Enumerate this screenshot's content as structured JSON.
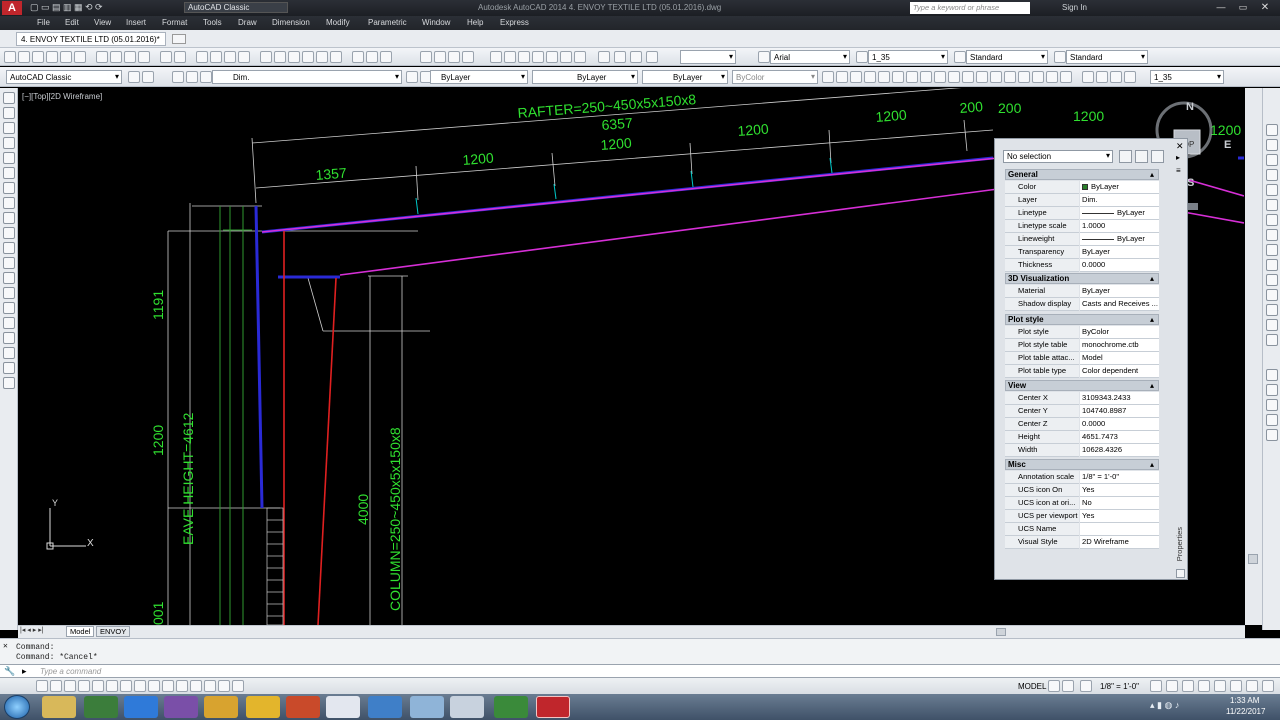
{
  "app": {
    "title": "Autodesk AutoCAD 2014    4. ENVOY TEXTILE LTD (05.01.2016).dwg",
    "workspace_quick": "AutoCAD Classic",
    "search_placeholder": "Type a keyword or phrase",
    "signin": "Sign In"
  },
  "menu": [
    "File",
    "Edit",
    "View",
    "Insert",
    "Format",
    "Tools",
    "Draw",
    "Dimension",
    "Modify",
    "Parametric",
    "Window",
    "Help",
    "Express"
  ],
  "doctab": "4. ENVOY TEXTILE LTD (05.01.2016)*",
  "toolbar": {
    "workspace": "AutoCAD Classic",
    "layer": "Dim.",
    "color": "ByLayer",
    "linetype": "ByLayer",
    "lineweight": "ByLayer",
    "plotstyle": "ByColor",
    "font": "Arial",
    "dimstyle": "1_35",
    "textstyle": "Standard",
    "tablestyle": "Standard",
    "scale": "1_35"
  },
  "viewport": {
    "label": "[−][Top][2D Wireframe]"
  },
  "drawing": {
    "rafter": "RAFTER=250~450x5x150x8",
    "total": "6357",
    "seg1": "1357",
    "seg2": "1200",
    "seg3": "1200",
    "seg4": "1200",
    "seg5": "1200",
    "seg6": "200",
    "seg7": "200",
    "seg8": "1200",
    "seg9": "1200",
    "column": "COLUMN=250~450x5x150x8",
    "eave": "EAVE HEIGHT=4612",
    "v1": "1191",
    "v2": "1200",
    "v3": "4000",
    "v4": "001"
  },
  "viewcube": {
    "n": "N",
    "e": "E",
    "s": "S",
    "top": "TOP"
  },
  "ucs": {
    "x": "X",
    "y": "Y"
  },
  "properties": {
    "selection": "No selection",
    "side_title": "Properties",
    "sections": [
      {
        "title": "General",
        "rows": [
          {
            "k": "Color",
            "v": "ByLayer"
          },
          {
            "k": "Layer",
            "v": "Dim."
          },
          {
            "k": "Linetype",
            "v": "ByLayer"
          },
          {
            "k": "Linetype scale",
            "v": "1.0000"
          },
          {
            "k": "Lineweight",
            "v": "ByLayer"
          },
          {
            "k": "Transparency",
            "v": "ByLayer"
          },
          {
            "k": "Thickness",
            "v": "0.0000"
          }
        ]
      },
      {
        "title": "3D Visualization",
        "rows": [
          {
            "k": "Material",
            "v": "ByLayer"
          },
          {
            "k": "Shadow display",
            "v": "Casts and Receives ..."
          }
        ]
      },
      {
        "title": "Plot style",
        "rows": [
          {
            "k": "Plot style",
            "v": "ByColor"
          },
          {
            "k": "Plot style table",
            "v": "monochrome.ctb"
          },
          {
            "k": "Plot table attac...",
            "v": "Model"
          },
          {
            "k": "Plot table type",
            "v": "Color dependent"
          }
        ]
      },
      {
        "title": "View",
        "rows": [
          {
            "k": "Center X",
            "v": "3109343.2433"
          },
          {
            "k": "Center Y",
            "v": "104740.8987"
          },
          {
            "k": "Center Z",
            "v": "0.0000"
          },
          {
            "k": "Height",
            "v": "4651.7473"
          },
          {
            "k": "Width",
            "v": "10628.4326"
          }
        ]
      },
      {
        "title": "Misc",
        "rows": [
          {
            "k": "Annotation scale",
            "v": "1/8\" = 1'-0\""
          },
          {
            "k": "UCS icon On",
            "v": "Yes"
          },
          {
            "k": "UCS icon at ori...",
            "v": "No"
          },
          {
            "k": "UCS per viewport",
            "v": "Yes"
          },
          {
            "k": "UCS Name",
            "v": ""
          },
          {
            "k": "Visual Style",
            "v": "2D Wireframe"
          }
        ]
      }
    ]
  },
  "layout_tabs": [
    "Model",
    "ENVOY"
  ],
  "command": {
    "line1": "Command:",
    "line2": "Command: *Cancel*",
    "placeholder": "Type a command"
  },
  "status": {
    "model": "MODEL",
    "scale": "1/8\" = 1'-0\""
  },
  "clock": {
    "time": "1:33 AM",
    "date": "11/22/2017"
  }
}
